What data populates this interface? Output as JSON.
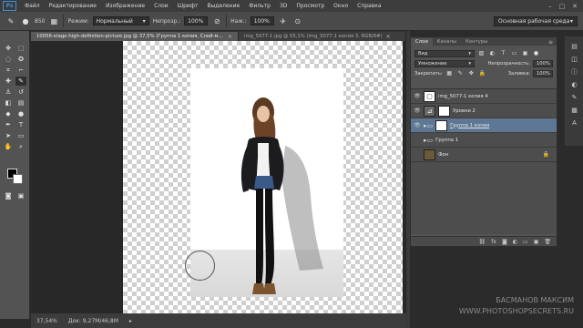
{
  "app": {
    "logo": "Ps"
  },
  "menu": [
    "Файл",
    "Редактирование",
    "Изображение",
    "Слои",
    "Шрифт",
    "Выделение",
    "Фильтр",
    "3D",
    "Просмотр",
    "Окно",
    "Справка"
  ],
  "window_controls": [
    "–",
    "□",
    "✕"
  ],
  "options_bar": {
    "brush_size": "850",
    "mode_label": "Режим:",
    "mode_value": "Нормальный",
    "opacity_label": "Непрозр.:",
    "opacity_value": "100%",
    "flow_label": "Наж.:",
    "flow_value": "100%",
    "workspace": "Основная рабочая среда"
  },
  "tabs": [
    {
      "label": "10056-stage-high-definition-picture.jpg @ 37,5% (Группа 1 копия, Слой-маска/8) *",
      "active": true
    },
    {
      "label": "img_5077-1.jpg @ 55,1% (img_5077-1 копия 3, RGB/8#)",
      "active": false
    }
  ],
  "status": {
    "zoom": "37,54%",
    "doc": "Док: 9,27M/46,8M"
  },
  "layers_panel": {
    "tabs": [
      "Слои",
      "Каналы",
      "Контуры"
    ],
    "filter_label": "Вид",
    "blend_mode": "Умножение",
    "opacity_label": "Непрозрачность:",
    "opacity_value": "100%",
    "lock_label": "Закрепить:",
    "fill_label": "Заливка:",
    "fill_value": "100%",
    "layers": [
      {
        "name": "img_5077-1 копия 4",
        "selected": false
      },
      {
        "name": "Уровни 2",
        "selected": false
      },
      {
        "name": "Группа 1 копия",
        "selected": true
      },
      {
        "name": "Группа 1",
        "selected": false
      },
      {
        "name": "Фон",
        "selected": false
      }
    ],
    "footer_icons": [
      "⛓",
      "fx",
      "◙",
      "◐",
      "▭",
      "▣",
      "🗑"
    ]
  },
  "watermark": {
    "line1": "БАСМАНОВ МАКСИМ",
    "line2": "WWW.PHOTOSHOPSECRETS.RU"
  }
}
